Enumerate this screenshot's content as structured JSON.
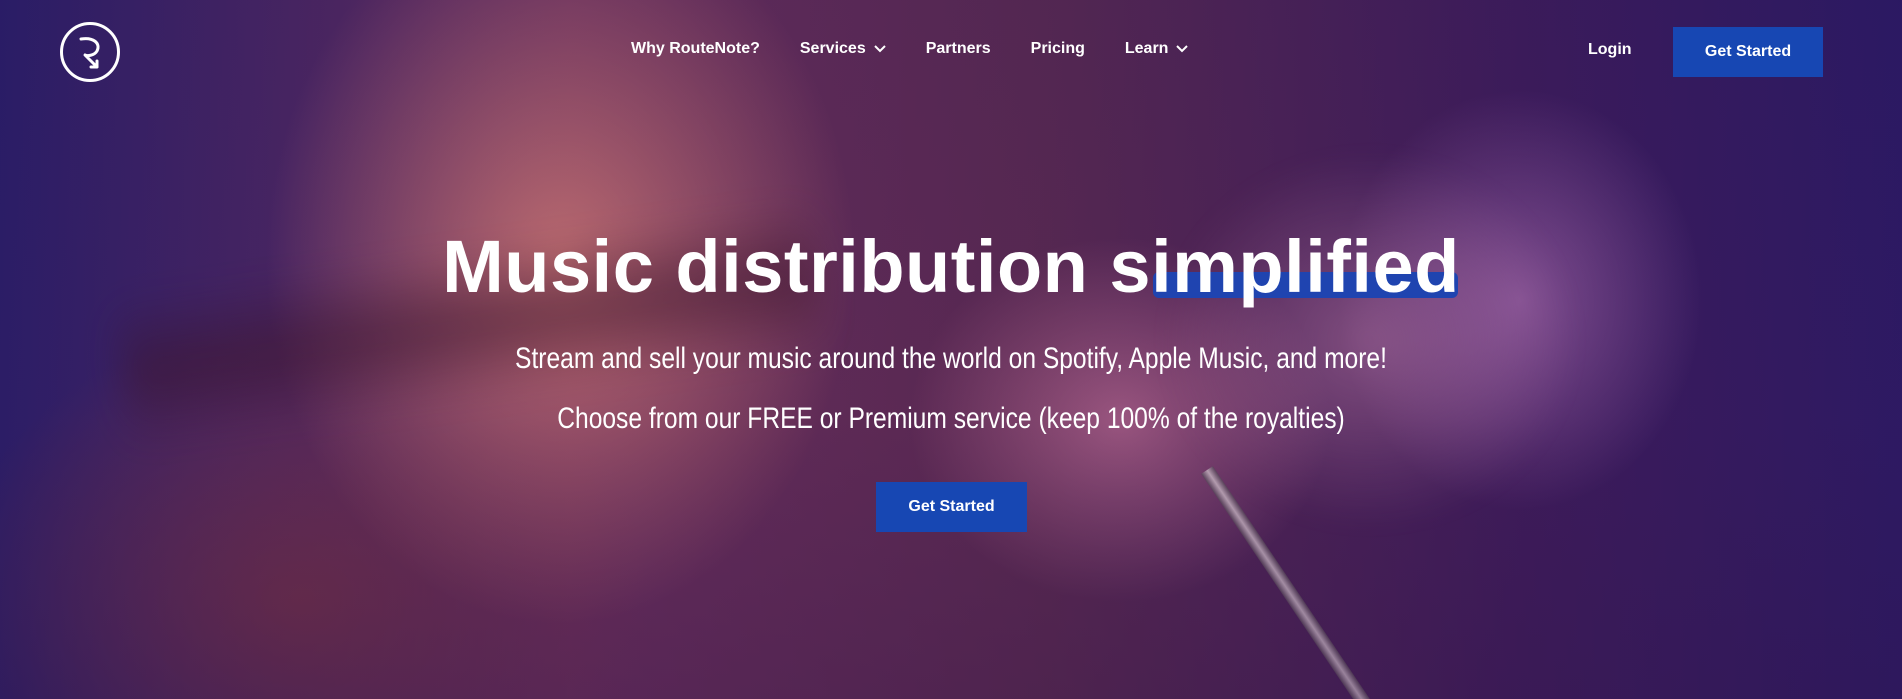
{
  "brand": {
    "logo_icon": "routenote-logo-icon"
  },
  "nav": {
    "items": [
      {
        "label": "Why RouteNote?",
        "has_dropdown": false
      },
      {
        "label": "Services",
        "has_dropdown": true
      },
      {
        "label": "Partners",
        "has_dropdown": false
      },
      {
        "label": "Pricing",
        "has_dropdown": false
      },
      {
        "label": "Learn",
        "has_dropdown": true
      }
    ],
    "login_label": "Login",
    "cta_label": "Get Started"
  },
  "hero": {
    "title_prefix": "Music distribution ",
    "title_highlight": "simplified",
    "subtitle_1": "Stream and sell your music around the world on Spotify, Apple Music, and more!",
    "subtitle_2": "Choose from our FREE or Premium service (keep 100% of the royalties)",
    "cta_label": "Get Started"
  },
  "colors": {
    "accent": "#1747b3",
    "highlight": "#1f44b0",
    "text": "#ffffff"
  }
}
